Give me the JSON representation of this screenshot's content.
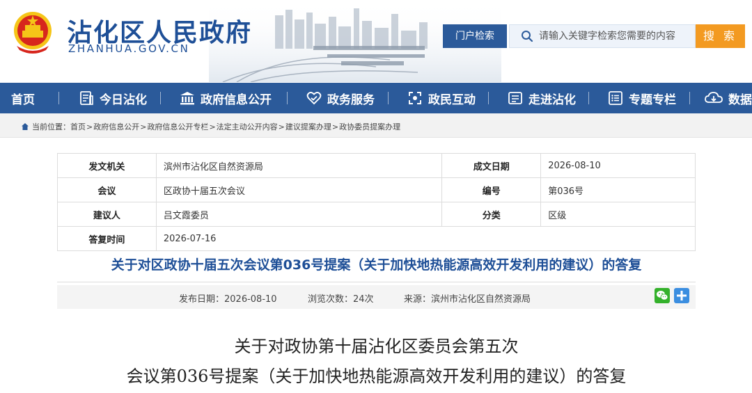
{
  "header": {
    "site_title": "沾化区人民政府",
    "site_domain": "ZHANHUA.GOV.CN",
    "portal_button": "门户检索",
    "search_placeholder": "请输入关键字检索您需要的内容",
    "search_button": "搜 索"
  },
  "nav": {
    "items": [
      {
        "label": "首页",
        "icon": "home-icon"
      },
      {
        "label": "今日沾化",
        "icon": "news-icon"
      },
      {
        "label": "政府信息公开",
        "icon": "government-building-icon"
      },
      {
        "label": "政务服务",
        "icon": "service-heart-icon"
      },
      {
        "label": "政民互动",
        "icon": "interaction-icon"
      },
      {
        "label": "走进沾化",
        "icon": "city-icon"
      },
      {
        "label": "专题专栏",
        "icon": "list-icon"
      },
      {
        "label": "数据",
        "icon": "cloud-download-icon"
      }
    ]
  },
  "breadcrumb": {
    "prefix": "当前位置：",
    "items": [
      "首页",
      "政府信息公开",
      "政府信息公开专栏",
      "法定主动公开内容",
      "建议提案办理",
      "政协委员提案办理"
    ]
  },
  "info_table": {
    "rows": [
      {
        "label1": "发文机关",
        "value1": "滨州市沾化区自然资源局",
        "label2": "成文日期",
        "value2": "2026-08-10"
      },
      {
        "label1": "会议",
        "value1": "区政协十届五次会议",
        "label2": "编号",
        "value2": "第036号"
      },
      {
        "label1": "建议人",
        "value1": "吕文霞委员",
        "label2": "分类",
        "value2": "区级"
      }
    ],
    "reply_time_label": "答复时间",
    "reply_time_value": "2026-07-16"
  },
  "article": {
    "headline": "关于对区政协十届五次会议第036号提案（关于加快地热能源高效开发利用的建议）的答复",
    "publish_date": "发布日期：2026-08-10",
    "views": "浏览次数：24次",
    "source": "来源：滨州市沾化区自然资源局",
    "body_title_line1": "关于对政协第十届沾化区委员会第五次",
    "body_title_line2": "会议第036号提案（关于加快地热能源高效开发利用的建议）的答复"
  },
  "colors": {
    "primary_blue": "#2b5a9a",
    "title_blue": "#1e4f97",
    "search_orange": "#f39a21",
    "emblem_red": "#d7261d",
    "emblem_gold": "#f5c518",
    "wechat_green": "#34b12b",
    "share_blue": "#3b8ee0"
  }
}
